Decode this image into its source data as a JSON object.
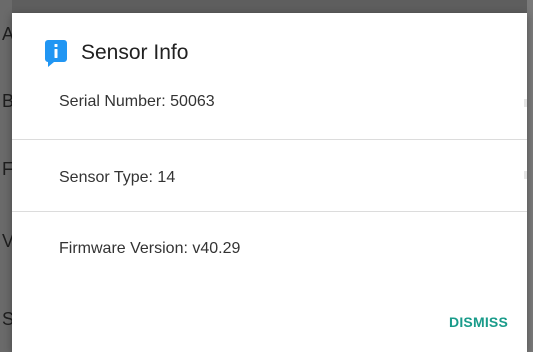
{
  "dialog": {
    "title": "Sensor Info",
    "icon": "info-icon",
    "accent_color": "#2196f3",
    "rows": [
      {
        "label": "Serial Number: 50063"
      },
      {
        "label": "Sensor Type: 14"
      },
      {
        "label": "Firmware Version: v40.29"
      }
    ],
    "dismiss_label": "DISMISS",
    "dismiss_color": "#199b8a"
  }
}
